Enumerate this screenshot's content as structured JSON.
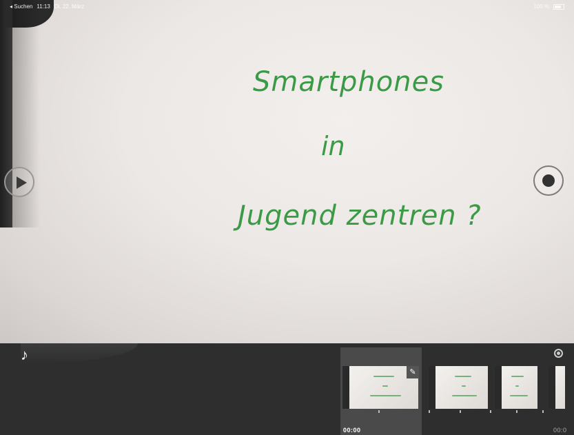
{
  "status_bar": {
    "back_label": "◂ Suchen",
    "time": "11:13",
    "date": "Di. 22. März",
    "right_text": "100 %"
  },
  "viewer": {
    "handwriting": [
      "Smartphones",
      "in",
      "Jugend zentren ?"
    ]
  },
  "timeline": {
    "time_start": "00:00",
    "time_end": "00:0"
  },
  "icons": {
    "play": "play-icon",
    "record": "record-icon",
    "music": "music-note-icon",
    "settings": "settings-icon",
    "edit": "edit-icon"
  }
}
